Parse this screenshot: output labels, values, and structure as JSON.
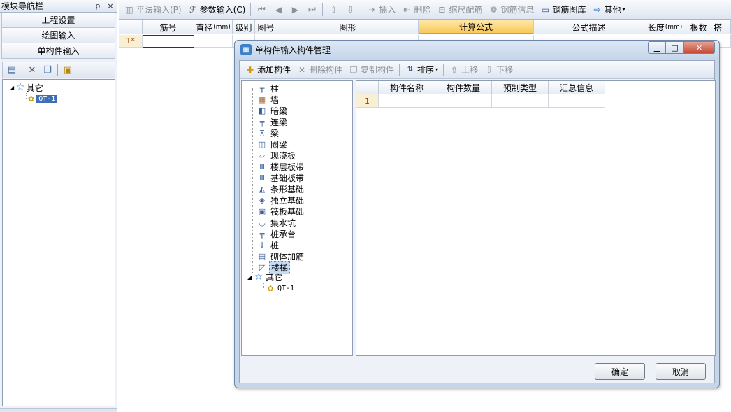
{
  "nav": {
    "title": "模块导航栏",
    "pin": "ᵽ",
    "close": "×",
    "buttons": [
      "工程设置",
      "绘图输入",
      "单构件输入"
    ],
    "tree": {
      "root": "其它",
      "child": "QT-1"
    }
  },
  "toolbar": {
    "items": [
      {
        "label": "平法输入(P)",
        "icon": "table-icon",
        "enabled": false
      },
      {
        "label": "参数输入(C)",
        "icon": "param-icon",
        "enabled": true
      },
      {
        "label": "插入",
        "icon": "insert-icon",
        "enabled": false
      },
      {
        "label": "删除",
        "icon": "delete-icon",
        "enabled": false
      },
      {
        "label": "缩尺配筋",
        "icon": "scale-icon",
        "enabled": false
      },
      {
        "label": "钢筋信息",
        "icon": "rebar-info-icon",
        "enabled": false
      },
      {
        "label": "钢筋图库",
        "icon": "rebar-lib-icon",
        "enabled": true
      },
      {
        "label": "其他",
        "icon": "other-icon",
        "enabled": true
      }
    ]
  },
  "grid": {
    "headers": [
      "筋号",
      "直径",
      "级别",
      "图号",
      "图形",
      "计算公式",
      "公式描述",
      "长度",
      "根数",
      "搭"
    ],
    "unit": "(mm)",
    "row1": "1*"
  },
  "dialog": {
    "title": "单构件输入构件管理",
    "toolbar": {
      "add": "添加构件",
      "delete": "删除构件",
      "copy": "复制构件",
      "sort": "排序",
      "up": "上移",
      "down": "下移"
    },
    "tree_items": [
      "柱",
      "墙",
      "暗梁",
      "连梁",
      "梁",
      "圈梁",
      "现浇板",
      "楼层板带",
      "基础板带",
      "条形基础",
      "独立基础",
      "筏板基础",
      "集水坑",
      "桩承台",
      "桩",
      "砌体加筋",
      "楼梯"
    ],
    "tree_other": "其它",
    "tree_other_child": "QT-1",
    "grid_headers": [
      "构件名称",
      "构件数量",
      "预制类型",
      "汇总信息"
    ],
    "grid_row1": "1",
    "ok": "确定",
    "cancel": "取消"
  }
}
